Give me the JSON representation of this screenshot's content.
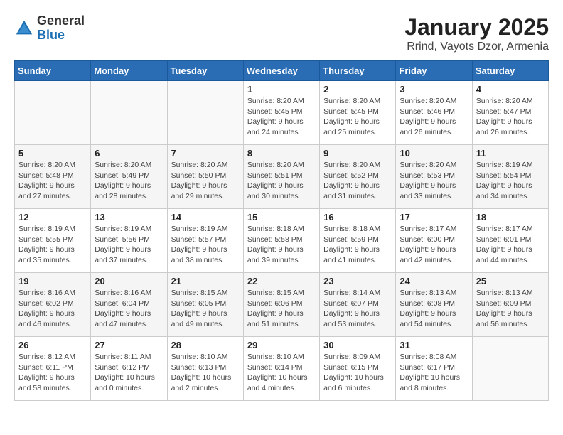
{
  "header": {
    "logo_general": "General",
    "logo_blue": "Blue",
    "title": "January 2025",
    "subtitle": "Rrind, Vayots Dzor, Armenia"
  },
  "days_of_week": [
    "Sunday",
    "Monday",
    "Tuesday",
    "Wednesday",
    "Thursday",
    "Friday",
    "Saturday"
  ],
  "weeks": [
    [
      {
        "day": "",
        "info": ""
      },
      {
        "day": "",
        "info": ""
      },
      {
        "day": "",
        "info": ""
      },
      {
        "day": "1",
        "info": "Sunrise: 8:20 AM\nSunset: 5:45 PM\nDaylight: 9 hours\nand 24 minutes."
      },
      {
        "day": "2",
        "info": "Sunrise: 8:20 AM\nSunset: 5:45 PM\nDaylight: 9 hours\nand 25 minutes."
      },
      {
        "day": "3",
        "info": "Sunrise: 8:20 AM\nSunset: 5:46 PM\nDaylight: 9 hours\nand 26 minutes."
      },
      {
        "day": "4",
        "info": "Sunrise: 8:20 AM\nSunset: 5:47 PM\nDaylight: 9 hours\nand 26 minutes."
      }
    ],
    [
      {
        "day": "5",
        "info": "Sunrise: 8:20 AM\nSunset: 5:48 PM\nDaylight: 9 hours\nand 27 minutes."
      },
      {
        "day": "6",
        "info": "Sunrise: 8:20 AM\nSunset: 5:49 PM\nDaylight: 9 hours\nand 28 minutes."
      },
      {
        "day": "7",
        "info": "Sunrise: 8:20 AM\nSunset: 5:50 PM\nDaylight: 9 hours\nand 29 minutes."
      },
      {
        "day": "8",
        "info": "Sunrise: 8:20 AM\nSunset: 5:51 PM\nDaylight: 9 hours\nand 30 minutes."
      },
      {
        "day": "9",
        "info": "Sunrise: 8:20 AM\nSunset: 5:52 PM\nDaylight: 9 hours\nand 31 minutes."
      },
      {
        "day": "10",
        "info": "Sunrise: 8:20 AM\nSunset: 5:53 PM\nDaylight: 9 hours\nand 33 minutes."
      },
      {
        "day": "11",
        "info": "Sunrise: 8:19 AM\nSunset: 5:54 PM\nDaylight: 9 hours\nand 34 minutes."
      }
    ],
    [
      {
        "day": "12",
        "info": "Sunrise: 8:19 AM\nSunset: 5:55 PM\nDaylight: 9 hours\nand 35 minutes."
      },
      {
        "day": "13",
        "info": "Sunrise: 8:19 AM\nSunset: 5:56 PM\nDaylight: 9 hours\nand 37 minutes."
      },
      {
        "day": "14",
        "info": "Sunrise: 8:19 AM\nSunset: 5:57 PM\nDaylight: 9 hours\nand 38 minutes."
      },
      {
        "day": "15",
        "info": "Sunrise: 8:18 AM\nSunset: 5:58 PM\nDaylight: 9 hours\nand 39 minutes."
      },
      {
        "day": "16",
        "info": "Sunrise: 8:18 AM\nSunset: 5:59 PM\nDaylight: 9 hours\nand 41 minutes."
      },
      {
        "day": "17",
        "info": "Sunrise: 8:17 AM\nSunset: 6:00 PM\nDaylight: 9 hours\nand 42 minutes."
      },
      {
        "day": "18",
        "info": "Sunrise: 8:17 AM\nSunset: 6:01 PM\nDaylight: 9 hours\nand 44 minutes."
      }
    ],
    [
      {
        "day": "19",
        "info": "Sunrise: 8:16 AM\nSunset: 6:02 PM\nDaylight: 9 hours\nand 46 minutes."
      },
      {
        "day": "20",
        "info": "Sunrise: 8:16 AM\nSunset: 6:04 PM\nDaylight: 9 hours\nand 47 minutes."
      },
      {
        "day": "21",
        "info": "Sunrise: 8:15 AM\nSunset: 6:05 PM\nDaylight: 9 hours\nand 49 minutes."
      },
      {
        "day": "22",
        "info": "Sunrise: 8:15 AM\nSunset: 6:06 PM\nDaylight: 9 hours\nand 51 minutes."
      },
      {
        "day": "23",
        "info": "Sunrise: 8:14 AM\nSunset: 6:07 PM\nDaylight: 9 hours\nand 53 minutes."
      },
      {
        "day": "24",
        "info": "Sunrise: 8:13 AM\nSunset: 6:08 PM\nDaylight: 9 hours\nand 54 minutes."
      },
      {
        "day": "25",
        "info": "Sunrise: 8:13 AM\nSunset: 6:09 PM\nDaylight: 9 hours\nand 56 minutes."
      }
    ],
    [
      {
        "day": "26",
        "info": "Sunrise: 8:12 AM\nSunset: 6:11 PM\nDaylight: 9 hours\nand 58 minutes."
      },
      {
        "day": "27",
        "info": "Sunrise: 8:11 AM\nSunset: 6:12 PM\nDaylight: 10 hours\nand 0 minutes."
      },
      {
        "day": "28",
        "info": "Sunrise: 8:10 AM\nSunset: 6:13 PM\nDaylight: 10 hours\nand 2 minutes."
      },
      {
        "day": "29",
        "info": "Sunrise: 8:10 AM\nSunset: 6:14 PM\nDaylight: 10 hours\nand 4 minutes."
      },
      {
        "day": "30",
        "info": "Sunrise: 8:09 AM\nSunset: 6:15 PM\nDaylight: 10 hours\nand 6 minutes."
      },
      {
        "day": "31",
        "info": "Sunrise: 8:08 AM\nSunset: 6:17 PM\nDaylight: 10 hours\nand 8 minutes."
      },
      {
        "day": "",
        "info": ""
      }
    ]
  ]
}
